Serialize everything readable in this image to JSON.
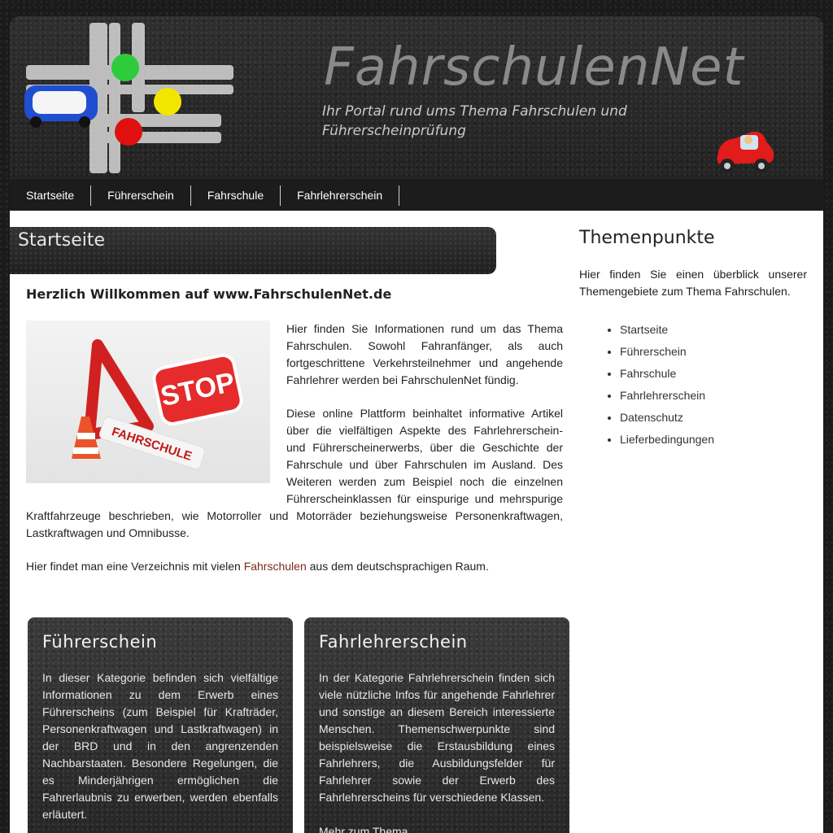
{
  "header": {
    "site_title": "FahrschulenNet",
    "tagline": "Ihr Portal rund ums Thema Fahrschulen und Führerscheinprüfung"
  },
  "nav": {
    "items": [
      {
        "label": "Startseite"
      },
      {
        "label": "Führerschein"
      },
      {
        "label": "Fahrschule"
      },
      {
        "label": "Fahrlehrerschein"
      }
    ]
  },
  "main": {
    "page_title": "Startseite",
    "welcome_heading": "Herzlich Willkommen auf www.FahrschulenNet.de",
    "hero_image": {
      "sign_text": "STOP",
      "sign_sub": "FAHRSCHULE"
    },
    "paragraphs": [
      "Hier finden Sie Informationen rund um das Thema Fahrschulen. Sowohl Fahranfänger, als auch fortgeschrittene Verkehrsteilnehmer und angehende Fahrlehrer werden bei FahrschulenNet fündig.",
      "Diese online Plattform beinhaltet informative Artikel über die vielfältigen Aspekte des Fahrlehrerschein- und Führerscheinerwerbs, über die Geschichte der Fahrschule und über Fahrschulen im Ausland. Des Weiteren werden zum Beispiel noch die einzelnen Führerscheinklassen für einspurige und mehrspurige Kraftfahrzeuge beschrieben, wie Motorroller und Motorräder beziehungsweise Personenkraftwagen, Lastkraftwagen und Omnibusse."
    ],
    "last_paragraph": {
      "before": "Hier findet man eine Verzeichnis mit vielen ",
      "link": "Fahrschulen",
      "after": " aus dem deutschsprachigen Raum."
    }
  },
  "boxes": [
    {
      "title": "Führerschein",
      "text": "In dieser Kategorie befinden sich vielfältige Informationen zu dem Erwerb eines Führerscheins (zum Beispiel für Krafträder, Personenkraftwagen und Lastkraftwagen) in der BRD und in den angrenzenden Nachbarstaaten. Besondere Regelungen, die es Minderjährigen ermöglichen die Fahrerlaubnis zu erwerben, werden ebenfalls erläutert.",
      "more": ""
    },
    {
      "title": "Fahrlehrerschein",
      "text": "In der Kategorie Fahrlehrerschein finden sich viele nützliche Infos für angehende Fahrlehrer und sonstige an diesem Bereich interessierte Menschen. Themenschwerpunkte sind beispielsweise die Erstausbildung eines Fahrlehrers, die Ausbildungsfelder für Fahrlehrer sowie der Erwerb des Fahrlehrerscheins für verschiedene Klassen.",
      "more": "Mehr zum Thema"
    }
  ],
  "sidebar": {
    "title": "Themenpunkte",
    "intro": "Hier finden Sie einen überblick unserer Themengebiete zum Thema Fahrschulen.",
    "items": [
      {
        "label": "Startseite"
      },
      {
        "label": "Führerschein"
      },
      {
        "label": "Fahrschule"
      },
      {
        "label": "Fahrlehrerschein"
      },
      {
        "label": "Datenschutz"
      },
      {
        "label": "Lieferbedingungen"
      }
    ]
  },
  "colors": {
    "link": "#7a2a1c",
    "nav_bg": "#1c1c1c",
    "traffic_green": "#2ecc3a",
    "traffic_yellow": "#f2e600",
    "traffic_red": "#e01010"
  }
}
